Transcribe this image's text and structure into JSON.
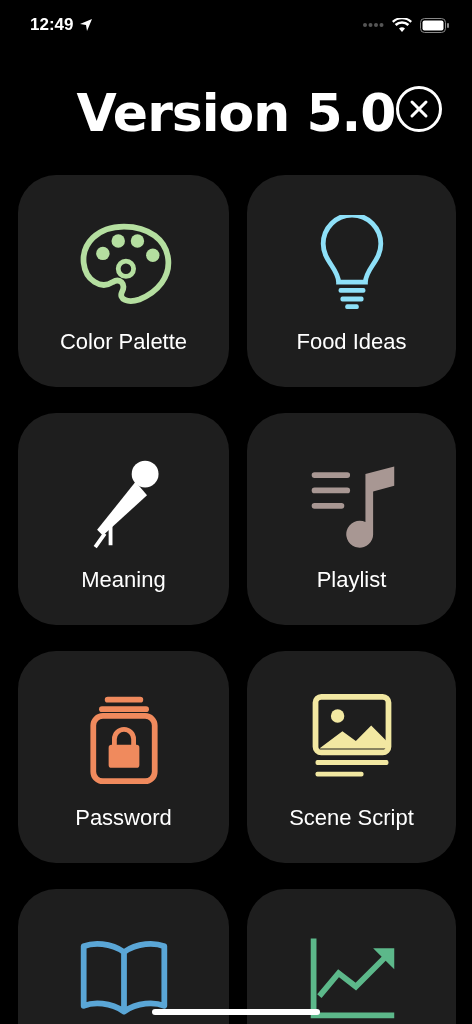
{
  "status_bar": {
    "time": "12:49"
  },
  "title": "Version 5.0",
  "tiles": [
    {
      "kind": "palette",
      "label": "Color Palette",
      "color": "#b5dfa0"
    },
    {
      "kind": "bulb",
      "label": "Food Ideas",
      "color": "#8ee0f8"
    },
    {
      "kind": "mic",
      "label": "Meaning",
      "color": "#ffffff"
    },
    {
      "kind": "playlist",
      "label": "Playlist",
      "color": "#a89793"
    },
    {
      "kind": "lock",
      "label": "Password",
      "color": "#f08a5d"
    },
    {
      "kind": "scene",
      "label": "Scene Script",
      "color": "#f2e8a2"
    },
    {
      "kind": "book",
      "color": "#5aa6d6"
    },
    {
      "kind": "chart",
      "color": "#5cb88a"
    }
  ]
}
